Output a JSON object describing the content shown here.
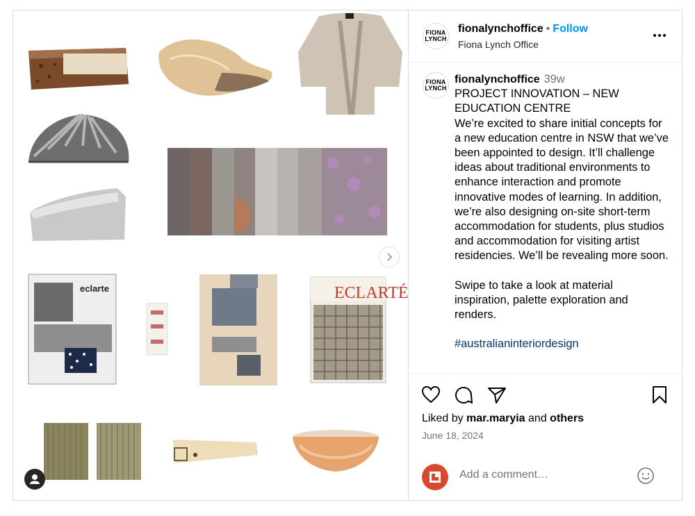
{
  "colors": {
    "accent": "#0095f6",
    "border": "#dbdbdb",
    "muted": "#737373",
    "comment_avatar": "#d6492f"
  },
  "post": {
    "username": "fionalynchoffice",
    "follow_label": "Follow",
    "subtitle": "Fiona Lynch Office",
    "logo_text": "FIONA\nLYNCH",
    "more_icon": "more-horizontal-icon"
  },
  "caption": {
    "username": "fionalynchoffice",
    "time": "39w",
    "title": "PROJECT INNOVATION – NEW EDUCATION CENTRE",
    "body": "We’re excited to share initial concepts for a new education centre in NSW that we’ve been appointed to design. It’ll challenge ideas about traditional environments to enhance interaction and promote innovative modes of learning. In addition, we’re also designing on-site short-term accommodation for students, plus studios and accommodation for visiting artist residencies. We’ll be revealing more soon.",
    "body2": "Swipe to take a look at material inspiration, palette exploration and renders.",
    "hashtag": "#australianinteriordesign"
  },
  "actions": {
    "like_icon": "heart-icon",
    "comment_icon": "comment-icon",
    "share_icon": "share-icon",
    "save_icon": "bookmark-icon",
    "liked_by_prefix": "Liked by",
    "liked_by_user": "mar.maryia",
    "and": "and",
    "others": "others",
    "date": "June 18, 2024"
  },
  "comment": {
    "placeholder": "Add a comment…",
    "emoji_icon": "emoji-icon"
  },
  "media": {
    "items": [
      "cork-block",
      "wool-tuft",
      "knit-cardigan",
      "metal-fan",
      "fabric-swatches",
      "aluminium-block",
      "eclarte-magazine",
      "small-label",
      "pattern-collage",
      "eclarte-sample-card",
      "woven-green-panels",
      "resin-belt",
      "orange-bowl"
    ],
    "next_icon": "chevron-right-icon",
    "user_icon": "user-tag-icon"
  }
}
